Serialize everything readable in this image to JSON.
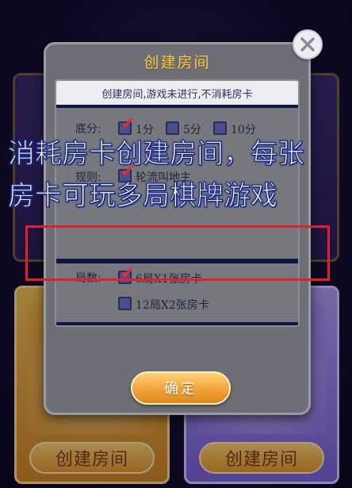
{
  "background": {
    "create_room_left": "创建房间",
    "create_room_right": "创建房间"
  },
  "dialog": {
    "title": "创建房间",
    "notice": "创建房间,游戏未进行,不消耗房卡",
    "base_score": {
      "label": "底分:",
      "options": [
        {
          "text": "1分",
          "checked": true
        },
        {
          "text": "5分",
          "checked": false
        },
        {
          "text": "10分",
          "checked": false
        }
      ]
    },
    "rules": {
      "label": "规则:",
      "option": {
        "text": "轮流叫地主",
        "checked": true
      }
    },
    "rounds": {
      "label": "局数:",
      "options": [
        {
          "text": "6局X1张房卡",
          "checked": true
        },
        {
          "text": "12局X2张房卡",
          "checked": false
        }
      ]
    },
    "confirm_label": "确定"
  },
  "caption": {
    "line1": "消耗房卡创建房间，每张",
    "line2": "房卡可玩多局棋牌游戏"
  },
  "colors": {
    "highlight": "#e0202a",
    "tick": "#e0332b",
    "title_gold": "#f3c95a"
  }
}
